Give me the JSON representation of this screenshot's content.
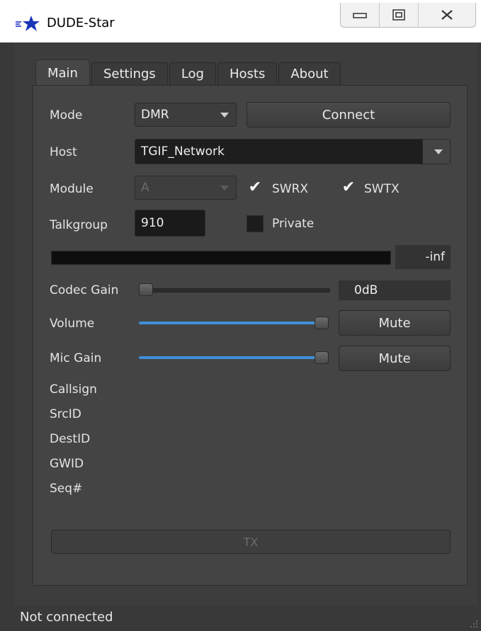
{
  "window": {
    "title": "DUDE-Star",
    "controls": [
      "minimize-icon",
      "maximize-icon",
      "close-icon"
    ]
  },
  "tabs": [
    {
      "label": "Main",
      "active": true
    },
    {
      "label": "Settings",
      "active": false
    },
    {
      "label": "Log",
      "active": false
    },
    {
      "label": "Hosts",
      "active": false
    },
    {
      "label": "About",
      "active": false
    }
  ],
  "main": {
    "mode_label": "Mode",
    "mode_value": "DMR",
    "connect_label": "Connect",
    "host_label": "Host",
    "host_value": "TGIF_Network",
    "module_label": "Module",
    "module_value": "A",
    "swrx_label": "SWRX",
    "swrx_checked": true,
    "swtx_label": "SWTX",
    "swtx_checked": true,
    "talkgroup_label": "Talkgroup",
    "talkgroup_value": "910",
    "private_label": "Private",
    "private_checked": false,
    "level_readout": "-inf",
    "codec_gain_label": "Codec Gain",
    "codec_gain_value": "0dB",
    "codec_gain_level": 0,
    "volume_label": "Volume",
    "volume_level": 1.0,
    "volume_mute_label": "Mute",
    "mic_gain_label": "Mic Gain",
    "mic_gain_level": 1.0,
    "mic_mute_label": "Mute",
    "info_labels": [
      "Callsign",
      "SrcID",
      "DestID",
      "GWID",
      "Seq#"
    ],
    "tx_label": "TX"
  },
  "status": {
    "text": "Not connected"
  },
  "colors": {
    "slider_fill": "#3f8fd8",
    "background": "#3a3a3a"
  }
}
